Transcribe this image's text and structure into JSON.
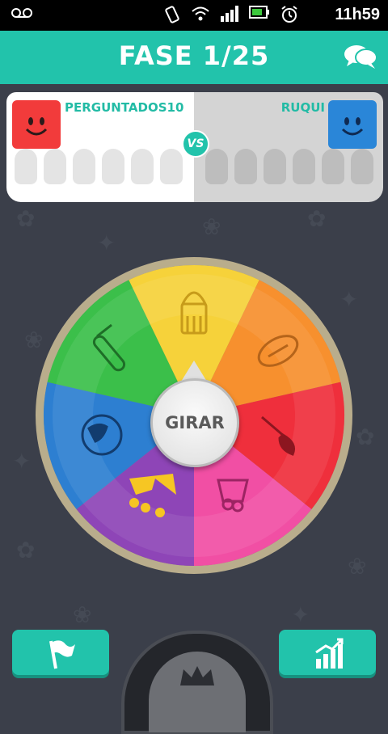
{
  "status_bar": {
    "time": "11h59"
  },
  "header": {
    "title": "FASE 1/25"
  },
  "players": {
    "left": {
      "name": "PERGUNTADOS10"
    },
    "right": {
      "name": "RUQUI"
    },
    "vs_label": "VS"
  },
  "wheel": {
    "spin_label": "GIRAR",
    "segments": [
      {
        "category": "arte",
        "icon": "crown-icon",
        "color": "#f6d23a"
      },
      {
        "category": "esporte",
        "icon": "football-icon",
        "color": "#f7902e"
      },
      {
        "category": "arte",
        "icon": "paintbrush-icon",
        "color": "#ef2f3c"
      },
      {
        "category": "entretenimento",
        "icon": "popcorn-icon",
        "color": "#f14fa4"
      },
      {
        "category": "coroa",
        "icon": "crown-icon",
        "color": "#8e45b7"
      },
      {
        "category": "geografia",
        "icon": "globe-icon",
        "color": "#2d7fd1"
      },
      {
        "category": "ciencia",
        "icon": "test-tube-icon",
        "color": "#3bbf4a"
      }
    ],
    "rim_color": "#b9ad8c"
  },
  "colors": {
    "accent": "#22c3ab",
    "background": "#3b3f4a"
  }
}
